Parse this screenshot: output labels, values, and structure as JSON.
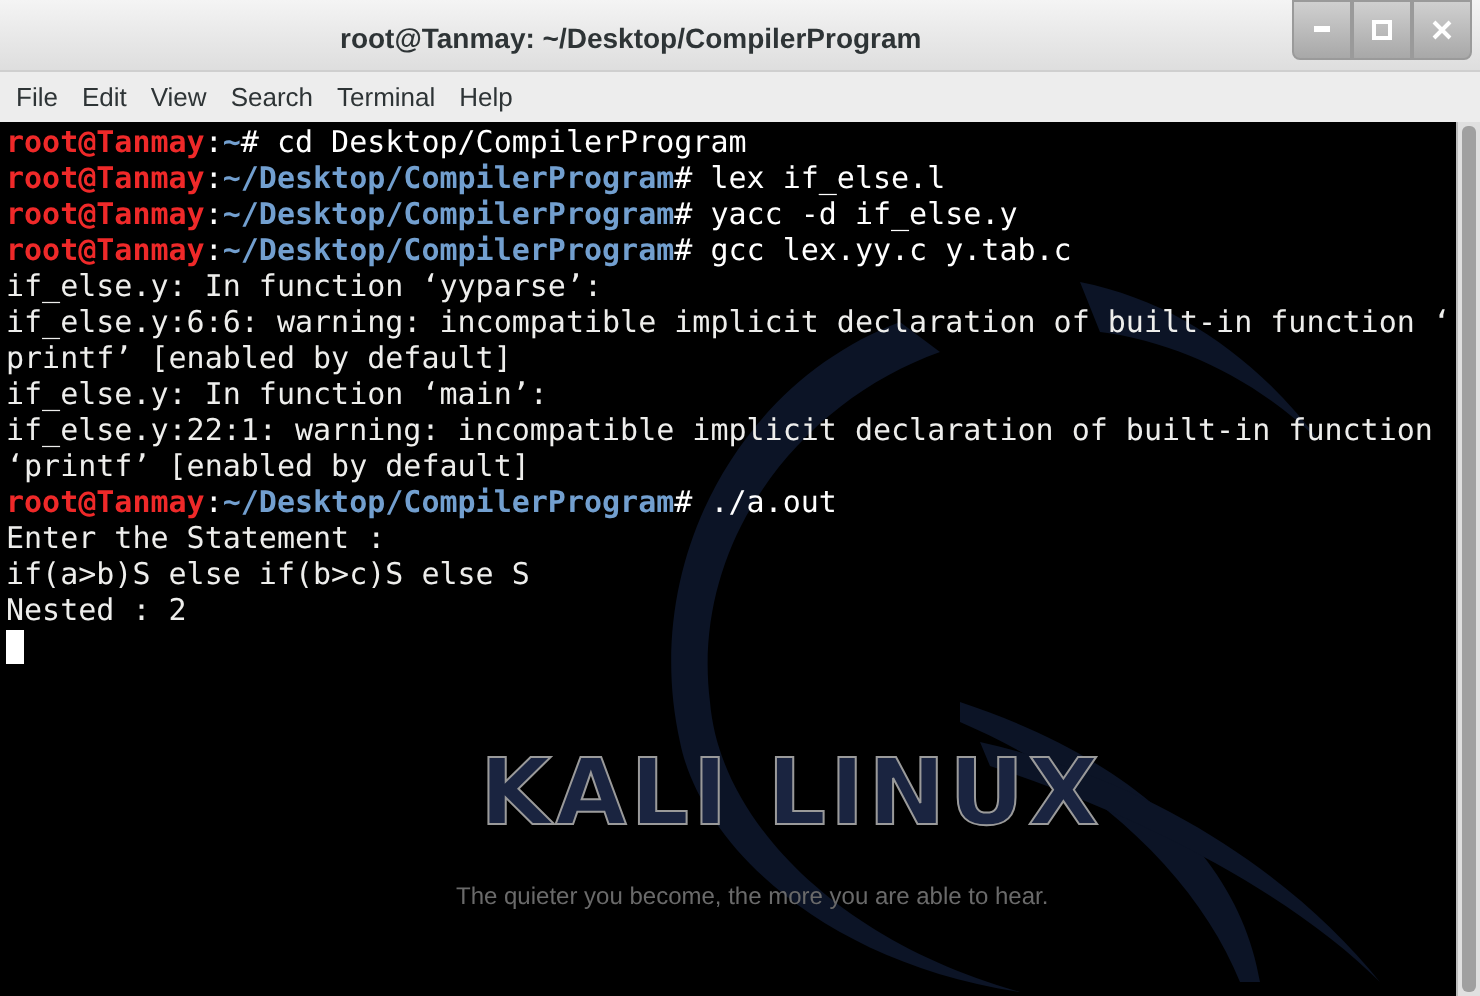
{
  "window": {
    "title": "root@Tanmay: ~/Desktop/CompilerProgram"
  },
  "menu": [
    "File",
    "Edit",
    "View",
    "Search",
    "Terminal",
    "Help"
  ],
  "terminal": {
    "lines": [
      {
        "kind": "prompt",
        "user": "root@Tanmay",
        "separator": ":",
        "path": "~",
        "command": "# cd Desktop/CompilerProgram"
      },
      {
        "kind": "prompt",
        "user": "root@Tanmay",
        "separator": ":",
        "path": "~/Desktop/CompilerProgram",
        "command": "# lex if_else.l"
      },
      {
        "kind": "prompt",
        "user": "root@Tanmay",
        "separator": ":",
        "path": "~/Desktop/CompilerProgram",
        "command": "# yacc -d if_else.y"
      },
      {
        "kind": "prompt",
        "user": "root@Tanmay",
        "separator": ":",
        "path": "~/Desktop/CompilerProgram",
        "command": "# gcc lex.yy.c y.tab.c"
      },
      {
        "kind": "output",
        "text": "if_else.y: In function ‘yyparse’:"
      },
      {
        "kind": "output",
        "text": "if_else.y:6:6: warning: incompatible implicit declaration of built-in function ‘"
      },
      {
        "kind": "output",
        "text": "printf’ [enabled by default]"
      },
      {
        "kind": "output",
        "text": "if_else.y: In function ‘main’:"
      },
      {
        "kind": "output",
        "text": "if_else.y:22:1: warning: incompatible implicit declaration of built-in function"
      },
      {
        "kind": "output",
        "text": "‘printf’ [enabled by default]"
      },
      {
        "kind": "prompt",
        "user": "root@Tanmay",
        "separator": ":",
        "path": "~/Desktop/CompilerProgram",
        "command": "# ./a.out"
      },
      {
        "kind": "output",
        "text": "Enter the Statement :"
      },
      {
        "kind": "output",
        "text": "if(a>b)S else if(b>c)S else S"
      },
      {
        "kind": "output",
        "text": "Nested : 2"
      }
    ]
  },
  "wallpaper": {
    "logo": "KALI LINUX",
    "tagline": "The quieter you become, the more you are able to hear."
  }
}
